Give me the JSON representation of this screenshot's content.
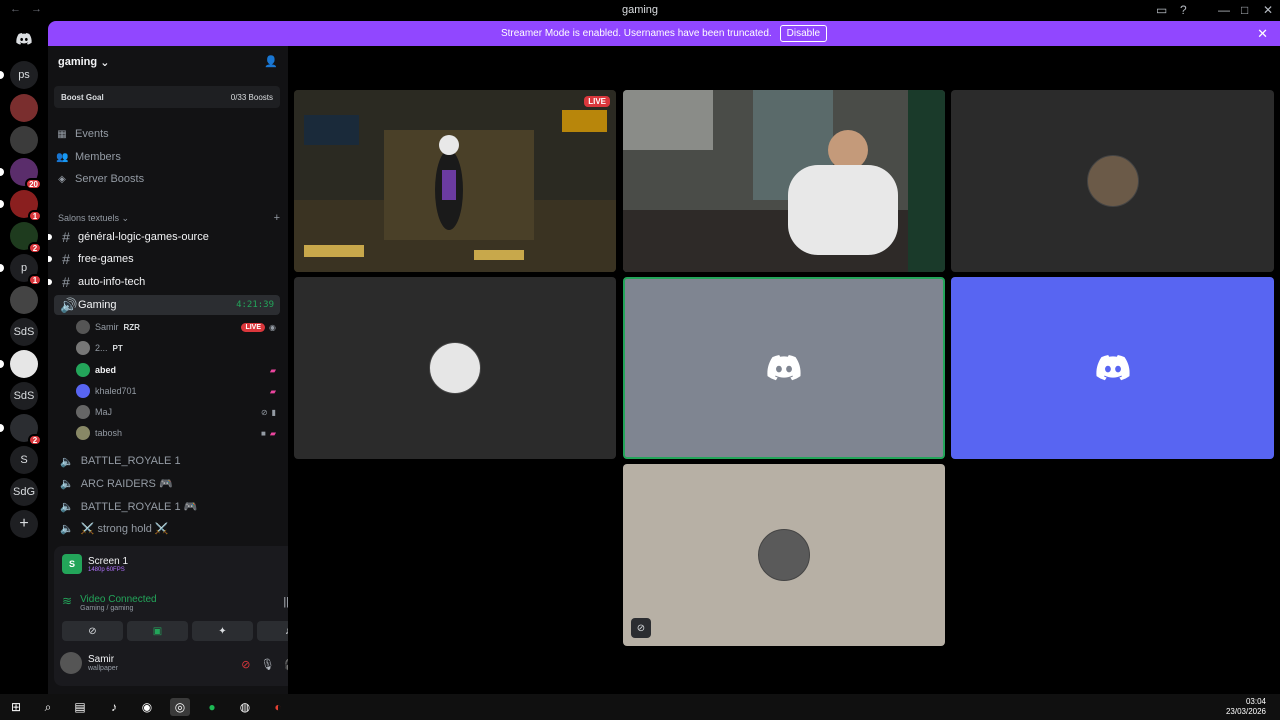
{
  "window": {
    "title": "gaming",
    "back": "←",
    "forward": "→"
  },
  "rail": [
    {
      "label": "",
      "icon": "discord-logo"
    },
    {
      "label": "ps"
    },
    {
      "label": "",
      "badge": ""
    },
    {
      "label": "",
      "badge": ""
    },
    {
      "label": "",
      "badge": "20"
    },
    {
      "label": "",
      "badge": "1"
    },
    {
      "label": "",
      "badge": "2"
    },
    {
      "label": "p",
      "badge": "1"
    },
    {
      "label": ""
    },
    {
      "label": "SdS"
    },
    {
      "label": ""
    },
    {
      "label": "SdS"
    },
    {
      "label": "",
      "badge": "2"
    },
    {
      "label": "S"
    },
    {
      "label": "SdG"
    },
    {
      "label": "+"
    }
  ],
  "banner": {
    "text": "Streamer Mode is enabled. Usernames have been truncated.",
    "button": "Disable"
  },
  "server": {
    "name": "gaming"
  },
  "boost": {
    "label": "Boost Goal",
    "value": "0/33 Boosts"
  },
  "nav": {
    "events": "Events",
    "members": "Members",
    "boosts": "Server Boosts"
  },
  "category": {
    "text_channels": "Salons textuels"
  },
  "channels": [
    "général-logic-games-ource",
    "free-games",
    "auto-info-tech"
  ],
  "voice": {
    "active": {
      "name": "Gaming",
      "timer": "4:21:39"
    },
    "users": [
      {
        "name": "Samir",
        "tag": "RZR",
        "live": "LIVE"
      },
      {
        "name": "2...",
        "tag": "PT"
      },
      {
        "name": "abed"
      },
      {
        "name": "khaled701"
      },
      {
        "name": "MaJ"
      },
      {
        "name": "tabosh"
      }
    ],
    "others": [
      "BATTLE_ROYALE 1",
      "ARC RAIDERS 🎮",
      "BATTLE_ROYALE 1 🎮",
      "⚔️ strong hold ⚔️"
    ]
  },
  "stream": {
    "title": "Screen 1",
    "quality": "1480p 60FPS"
  },
  "connection": {
    "status": "Video Connected",
    "location": "Gaming / gaming"
  },
  "me": {
    "name": "Samir",
    "status": "wallpaper"
  },
  "tiles": {
    "live": "LIVE"
  },
  "clock": {
    "time": "03:04",
    "date": "23/03/2026"
  },
  "colors": {
    "accent": "#5865f2",
    "banner": "#9147ff",
    "green": "#23a55a",
    "red": "#da373c"
  }
}
